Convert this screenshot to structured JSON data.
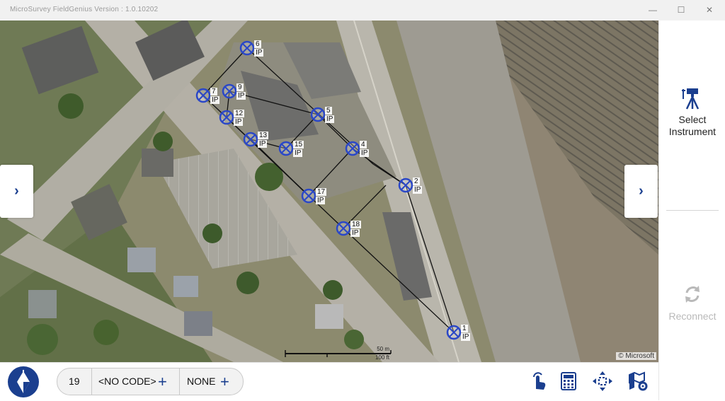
{
  "window": {
    "title": "MicroSurvey FieldGenius Version : 1.0.10202",
    "minimize_glyph": "—",
    "maximize_glyph": "☐",
    "close_glyph": "✕"
  },
  "map": {
    "nav_left_glyph": "›",
    "nav_right_glyph": "›",
    "scale_metric": "50 m",
    "scale_imperial": "100 ft",
    "copyright": "© Microsoft",
    "points": [
      {
        "id": "1",
        "code": "IP"
      },
      {
        "id": "2",
        "code": "IP"
      },
      {
        "id": "4",
        "code": "IP"
      },
      {
        "id": "5",
        "code": "IP"
      },
      {
        "id": "6",
        "code": "IP"
      },
      {
        "id": "7",
        "code": "IP"
      },
      {
        "id": "9",
        "code": "IP"
      },
      {
        "id": "12",
        "code": "IP"
      },
      {
        "id": "13",
        "code": "IP"
      },
      {
        "id": "15",
        "code": "IP"
      },
      {
        "id": "17",
        "code": "IP"
      },
      {
        "id": "18",
        "code": "IP"
      }
    ]
  },
  "sidebar": {
    "select_instrument_line1": "Select",
    "select_instrument_line2": "Instrument",
    "reconnect_label": "Reconnect",
    "icons": {
      "select_instrument": "tripod-instrument-icon",
      "reconnect": "refresh-icon"
    }
  },
  "bottom_bar": {
    "point_number": "19",
    "code_value": "<NO CODE>",
    "layer_value": "NONE",
    "add_glyph": "+",
    "icons": [
      "plumb-bob-logo-icon",
      "touch-hand-icon",
      "calculator-icon",
      "zoom-extents-icon",
      "map-settings-icon"
    ]
  },
  "colors": {
    "accent_blue": "#1b3f8f",
    "point_marker": "#2a47c7",
    "reconnect_disabled": "#b9b9b9"
  }
}
